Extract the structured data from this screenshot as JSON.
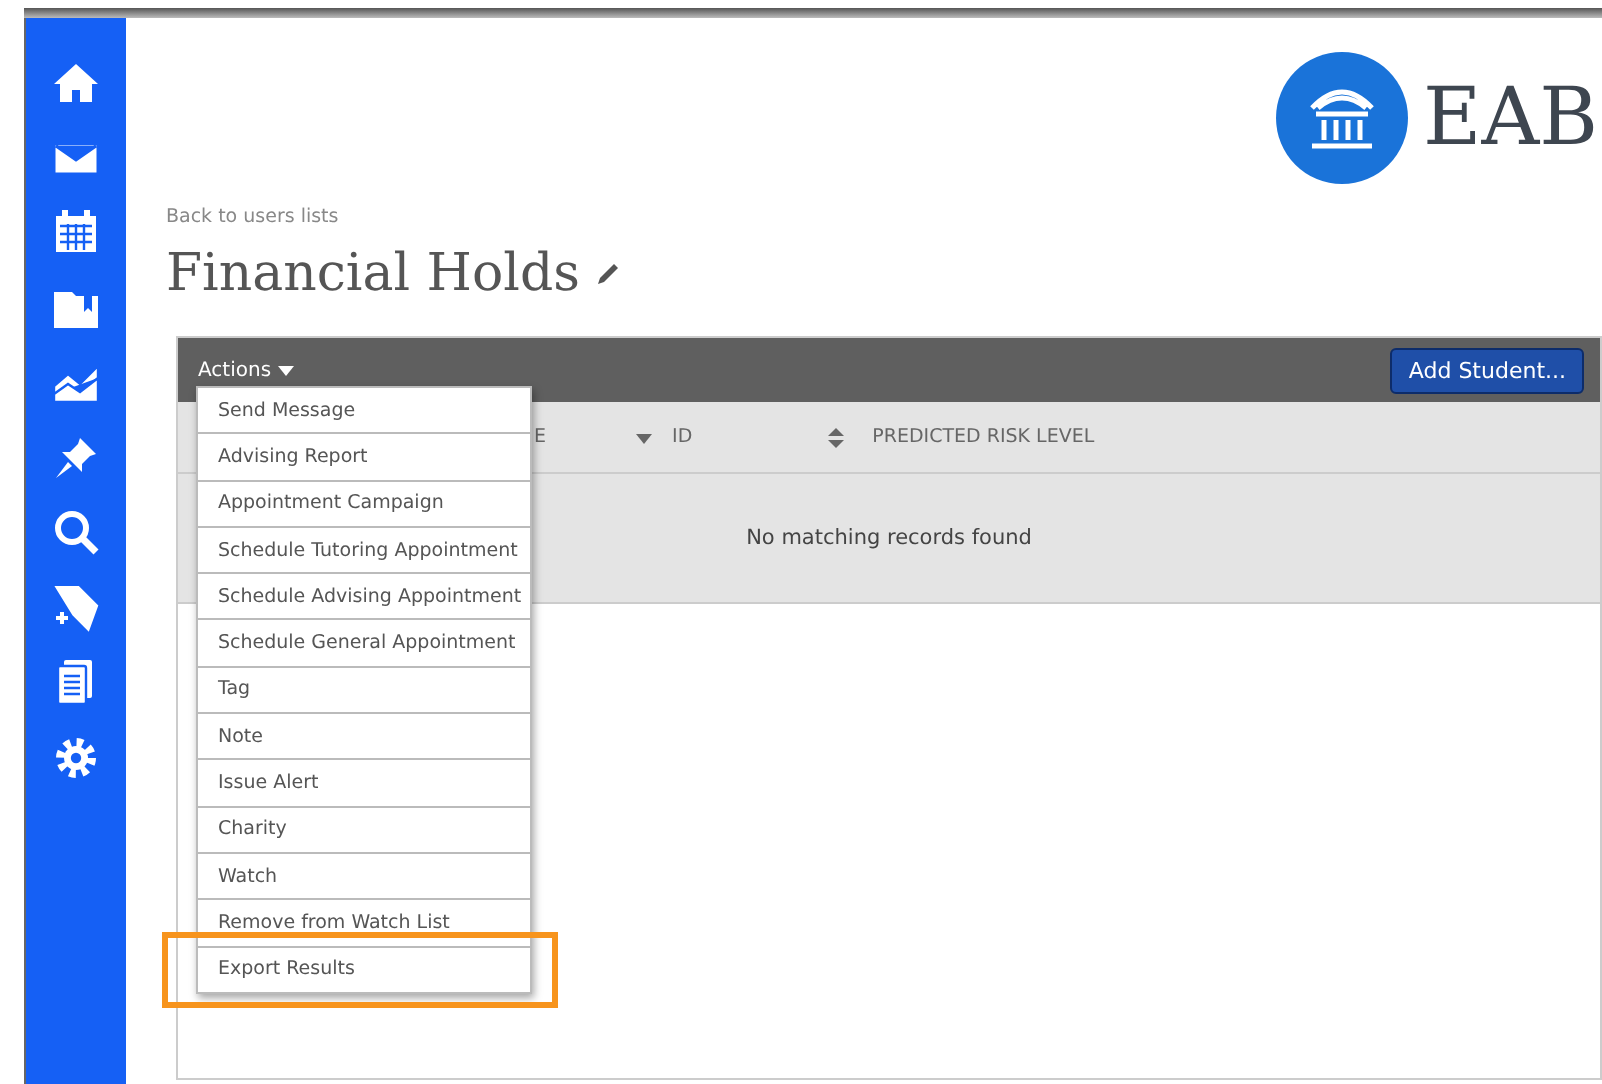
{
  "logo": {
    "text": "EAB"
  },
  "back_link": "Back to users lists",
  "title": "Financial Holds",
  "toolbar": {
    "actions_label": "Actions",
    "add_button": "Add Student..."
  },
  "table": {
    "columns": [
      {
        "label": "E",
        "kind": "sorted"
      },
      {
        "label": "ID",
        "kind": "sortable"
      },
      {
        "label": "PREDICTED RISK LEVEL",
        "kind": "plain"
      }
    ],
    "empty_message": "No matching records found"
  },
  "actions_menu": {
    "items": [
      {
        "label": "Send Message",
        "highlighted": false
      },
      {
        "label": "Advising Report",
        "highlighted": false
      },
      {
        "label": "Appointment Campaign",
        "highlighted": false
      },
      {
        "label": "Schedule Tutoring Appointment",
        "highlighted": false
      },
      {
        "label": "Schedule Advising Appointment",
        "highlighted": false
      },
      {
        "label": "Schedule General Appointment",
        "highlighted": false
      },
      {
        "label": "Tag",
        "highlighted": false
      },
      {
        "label": "Note",
        "highlighted": false
      },
      {
        "label": "Issue Alert",
        "highlighted": false
      },
      {
        "label": "Charity",
        "highlighted": false
      },
      {
        "label": "Watch",
        "highlighted": false
      },
      {
        "label": "Remove from Watch List",
        "highlighted": false
      },
      {
        "label": "Export Results",
        "highlighted": true
      }
    ]
  }
}
